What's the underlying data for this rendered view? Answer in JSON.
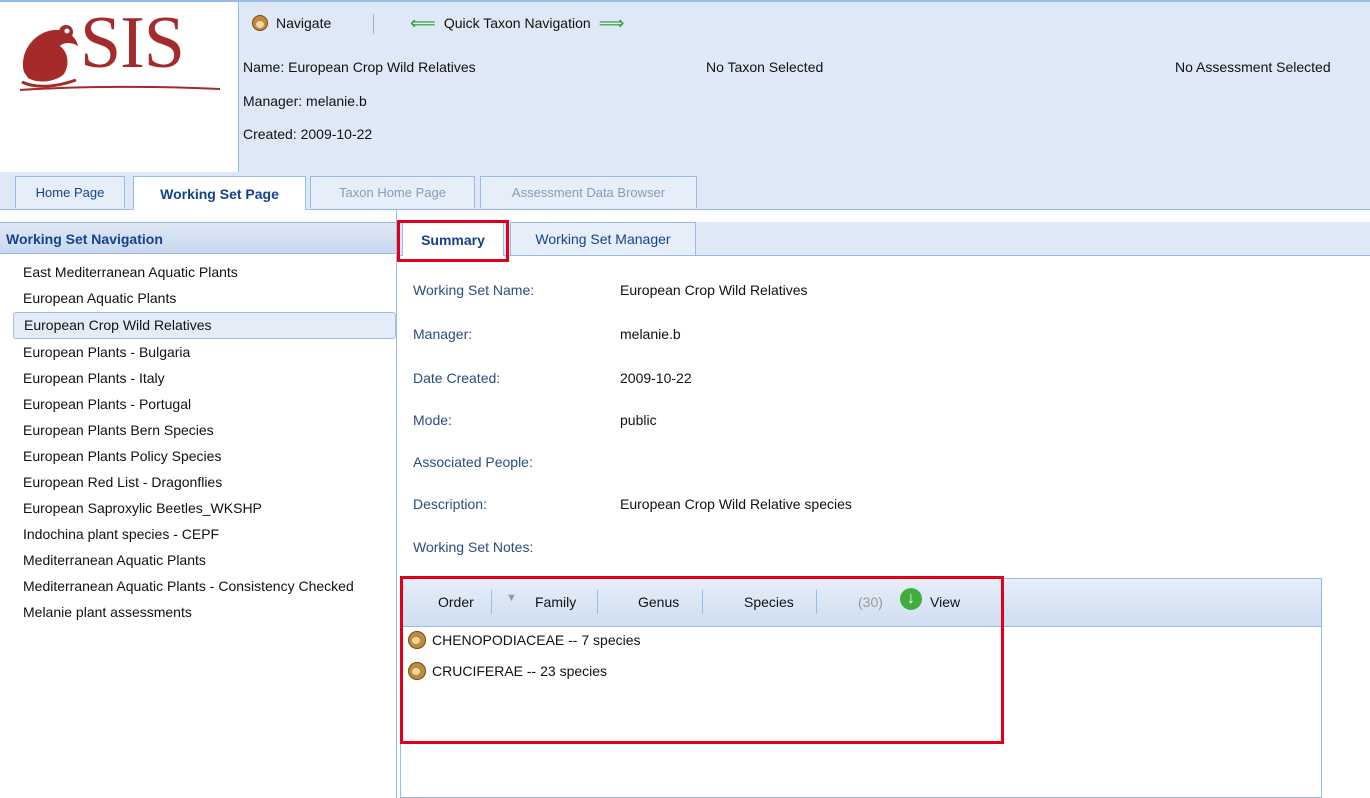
{
  "header": {
    "logo_text": "SIS",
    "navigate_label": "Navigate",
    "quick_taxon_label": "Quick Taxon Navigation",
    "working_set_name": "Name: European Crop Wild Relatives",
    "manager": "Manager: melanie.b",
    "created": "Created: 2009-10-22",
    "taxon_status": "No Taxon Selected",
    "assessment_status": "No Assessment Selected"
  },
  "main_tabs": [
    {
      "label": "Home Page"
    },
    {
      "label": "Working Set Page"
    },
    {
      "label": "Taxon Home Page"
    },
    {
      "label": "Assessment Data Browser"
    }
  ],
  "left_nav": {
    "title": "Working Set Navigation",
    "items": [
      "East Mediterranean Aquatic Plants",
      "European Aquatic Plants",
      "European Crop Wild Relatives",
      "European Plants - Bulgaria",
      "European Plants - Italy",
      "European Plants - Portugal",
      "European Plants Bern Species",
      "European Plants Policy Species",
      "European Red List - Dragonflies",
      "European Saproxylic Beetles_WKSHP",
      "Indochina plant species - CEPF",
      "Mediterranean Aquatic Plants",
      "Mediterranean Aquatic Plants - Consistency Checked",
      "Melanie plant assessments"
    ]
  },
  "sub_tabs": [
    {
      "label": "Summary"
    },
    {
      "label": "Working Set Manager"
    }
  ],
  "summary": {
    "fields": [
      {
        "label": "Working Set Name:",
        "value": "European Crop Wild Relatives"
      },
      {
        "label": "Manager:",
        "value": "melanie.b"
      },
      {
        "label": "Date Created:",
        "value": "2009-10-22"
      },
      {
        "label": "Mode:",
        "value": "public"
      },
      {
        "label": "Associated People:",
        "value": ""
      },
      {
        "label": "Description:",
        "value": "European Crop Wild Relative species"
      },
      {
        "label": "Working Set Notes:",
        "value": ""
      }
    ]
  },
  "taxa_grid": {
    "toolbar": {
      "order": "Order",
      "family": "Family",
      "genus": "Genus",
      "species": "Species",
      "count": "(30)",
      "view": "View"
    },
    "rows": [
      "CHENOPODIACEAE -- 7 species",
      "CRUCIFERAE -- 23 species"
    ]
  },
  "colors": {
    "highlight": "#e0001a",
    "header_bg": "#dfe8f6",
    "tab_text": "#15428b",
    "logo": "#a52a2a"
  }
}
